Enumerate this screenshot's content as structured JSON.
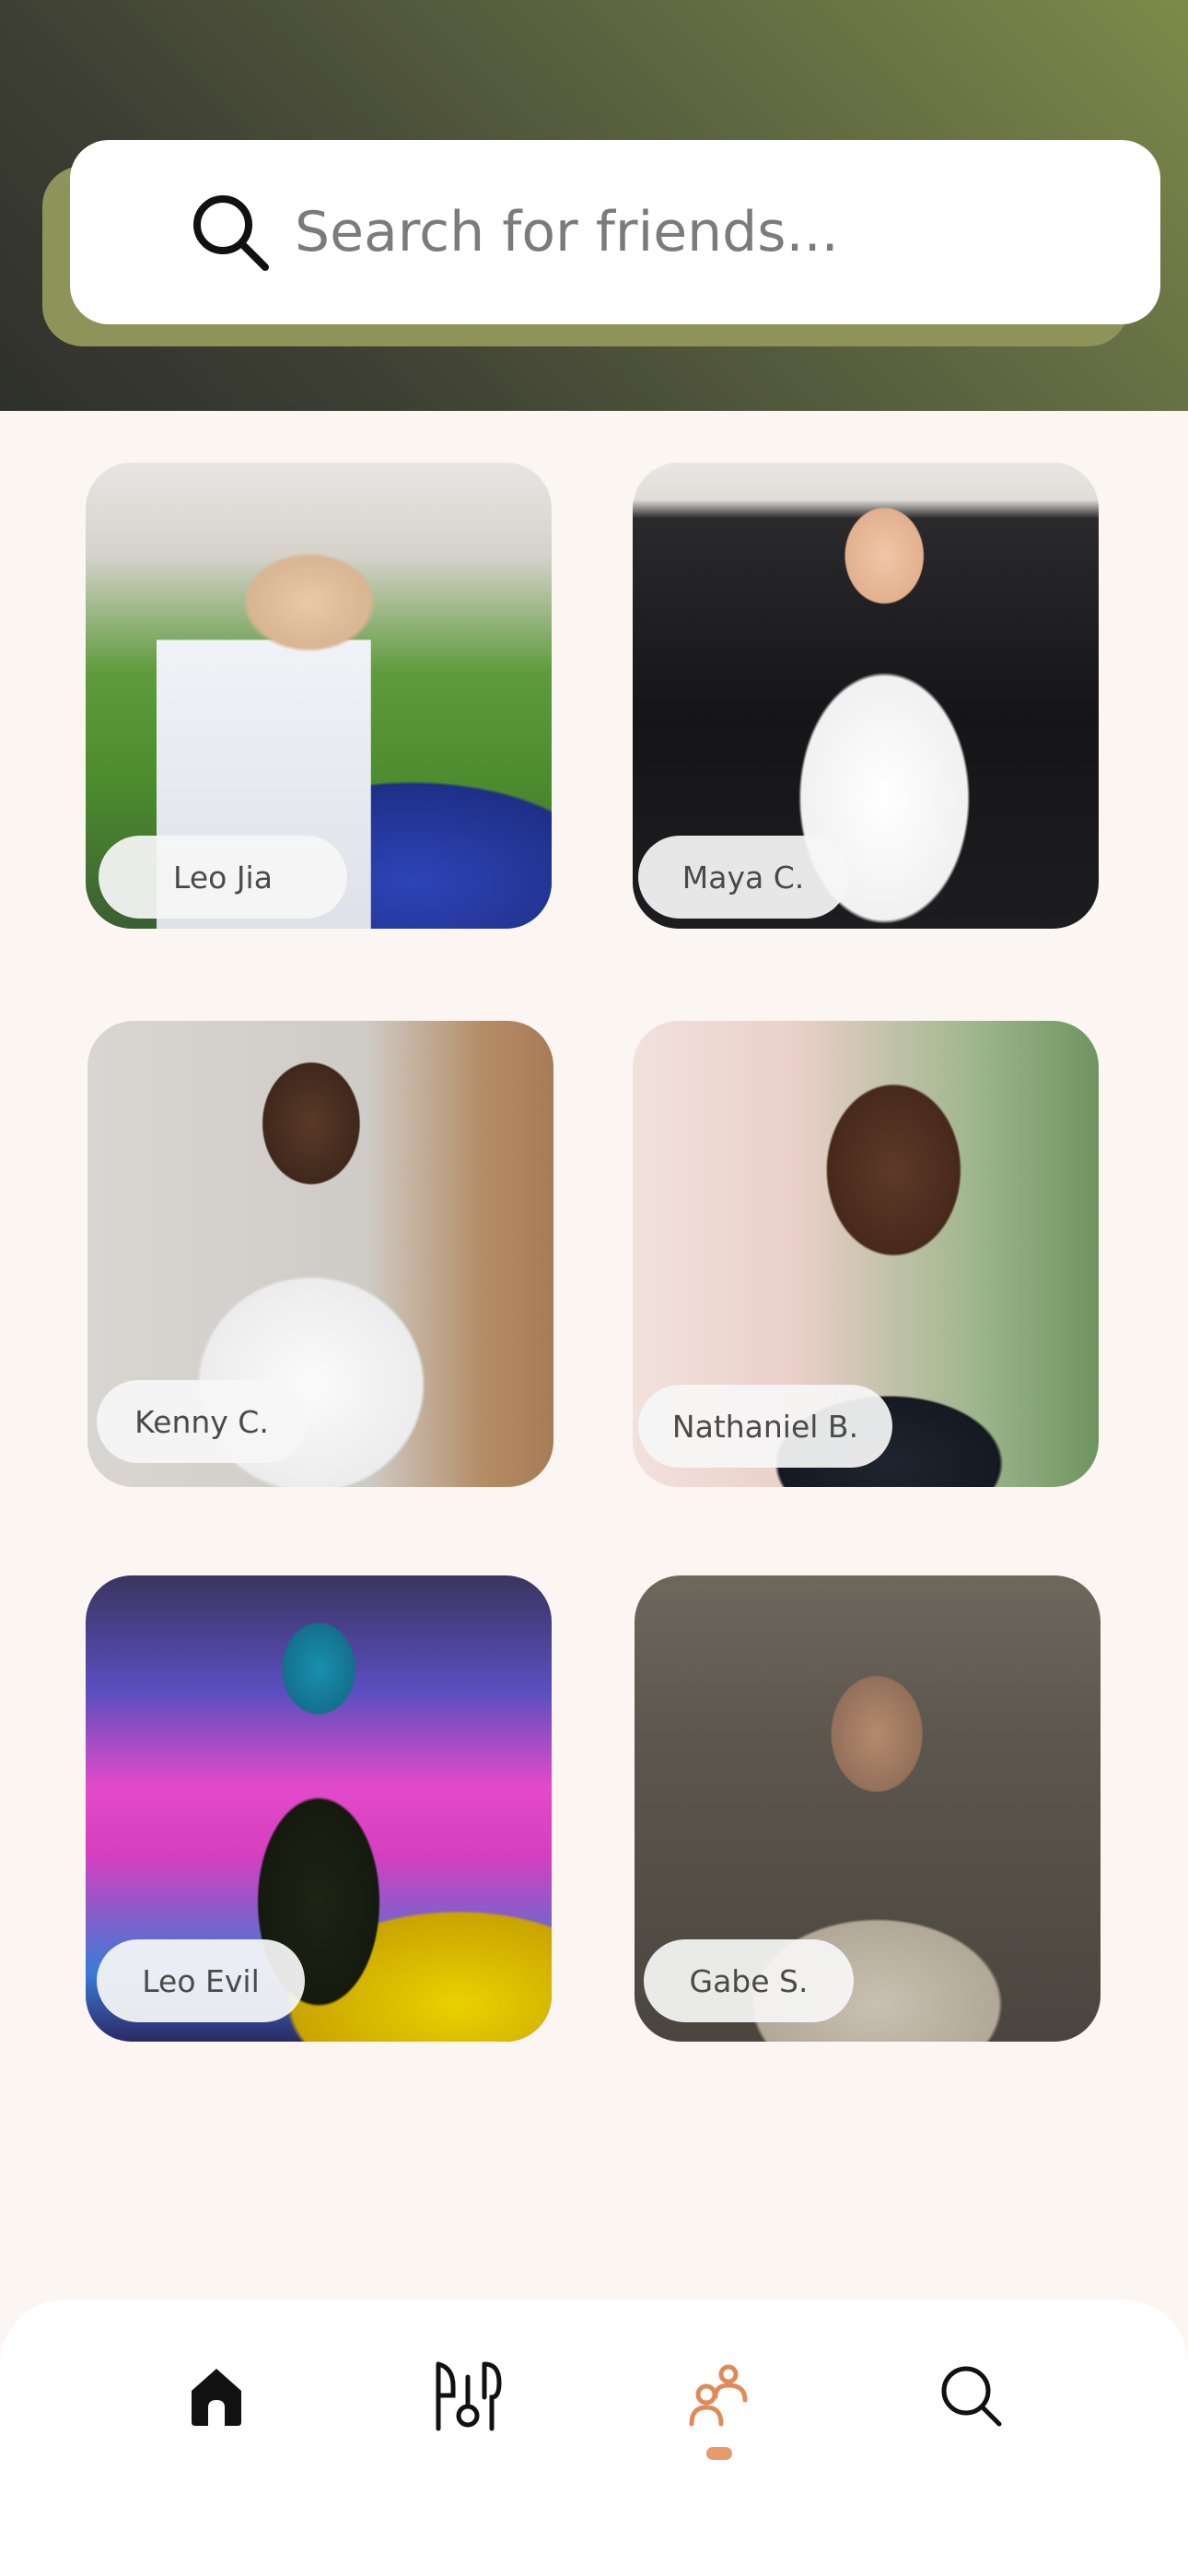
{
  "search": {
    "placeholder": "Search for friends..."
  },
  "friends": [
    {
      "name": "Leo Jia"
    },
    {
      "name": "Maya C."
    },
    {
      "name": "Kenny C."
    },
    {
      "name": "Nathaniel B."
    },
    {
      "name": "Leo Evil"
    },
    {
      "name": "Gabe S."
    }
  ],
  "nav": {
    "items": [
      {
        "icon": "home-icon",
        "active": false
      },
      {
        "icon": "utensils-icon",
        "active": false
      },
      {
        "icon": "friends-icon",
        "active": true
      },
      {
        "icon": "search-icon",
        "active": false
      }
    ]
  },
  "colors": {
    "header_dark": "#2f302b",
    "header_olive": "#7e8a4a",
    "search_shadow": "#8d9359",
    "background": "#fcf6f2",
    "active_accent": "#e08a5a"
  }
}
